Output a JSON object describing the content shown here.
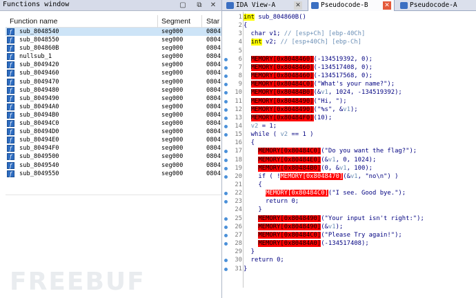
{
  "functions_window": {
    "title": "Functions window",
    "columns": [
      "Function name",
      "Segment",
      "Star"
    ],
    "rows": [
      {
        "name": "sub_8048540",
        "segment": "seg000",
        "start": "0804",
        "selected": true
      },
      {
        "name": "sub_8048550",
        "segment": "seg000",
        "start": "0804"
      },
      {
        "name": "sub_804860B",
        "segment": "seg000",
        "start": "0804"
      },
      {
        "name": "nullsub_1",
        "segment": "seg000",
        "start": "0804"
      },
      {
        "name": "sub_8049420",
        "segment": "seg000",
        "start": "0804"
      },
      {
        "name": "sub_8049460",
        "segment": "seg000",
        "start": "0804"
      },
      {
        "name": "sub_8049470",
        "segment": "seg000",
        "start": "0804"
      },
      {
        "name": "sub_8049480",
        "segment": "seg000",
        "start": "0804"
      },
      {
        "name": "sub_8049490",
        "segment": "seg000",
        "start": "0804"
      },
      {
        "name": "sub_80494A0",
        "segment": "seg000",
        "start": "0804"
      },
      {
        "name": "sub_80494B0",
        "segment": "seg000",
        "start": "0804"
      },
      {
        "name": "sub_80494C0",
        "segment": "seg000",
        "start": "0804"
      },
      {
        "name": "sub_80494D0",
        "segment": "seg000",
        "start": "0804"
      },
      {
        "name": "sub_80494E0",
        "segment": "seg000",
        "start": "0804"
      },
      {
        "name": "sub_80494F0",
        "segment": "seg000",
        "start": "0804"
      },
      {
        "name": "sub_8049500",
        "segment": "seg000",
        "start": "0804"
      },
      {
        "name": "sub_8049540",
        "segment": "seg000",
        "start": "0804"
      },
      {
        "name": "sub_8049550",
        "segment": "seg000",
        "start": "0804"
      }
    ]
  },
  "tabs": [
    {
      "label": "IDA View-A",
      "icon_color": "#3b6fc2",
      "active": false
    },
    {
      "label": "Pseudocode-B",
      "icon_color": "#3b6fc2",
      "active": true
    },
    {
      "label": "Pseudocode-A",
      "icon_color": "#3b6fc2",
      "active": false
    }
  ],
  "code_lines": [
    {
      "n": "1",
      "dot": false,
      "parts": [
        [
          "kw",
          "int"
        ],
        [
          "t",
          " sub_804860B()"
        ]
      ]
    },
    {
      "n": "2",
      "dot": false,
      "parts": [
        [
          "t",
          "{"
        ]
      ]
    },
    {
      "n": "3",
      "dot": false,
      "parts": [
        [
          "t",
          "  char v1; "
        ],
        [
          "v",
          "// [esp+Ch] [ebp-40Ch]"
        ]
      ]
    },
    {
      "n": "4",
      "dot": false,
      "parts": [
        [
          "t",
          "  "
        ],
        [
          "kw",
          "int"
        ],
        [
          "t",
          " v2; "
        ],
        [
          "v",
          "// [esp+40Ch] [ebp-Ch]"
        ]
      ]
    },
    {
      "n": "5",
      "dot": false,
      "parts": [
        [
          "t",
          ""
        ]
      ]
    },
    {
      "n": "6",
      "dot": true,
      "parts": [
        [
          "t",
          "  "
        ],
        [
          "m",
          "MEMORY[0x8048460]"
        ],
        [
          "t",
          "(-134519392, 0);"
        ]
      ]
    },
    {
      "n": "7",
      "dot": true,
      "parts": [
        [
          "t",
          "  "
        ],
        [
          "m",
          "MEMORY[0x8048460]"
        ],
        [
          "t",
          "(-134517408, 0);"
        ]
      ]
    },
    {
      "n": "8",
      "dot": true,
      "parts": [
        [
          "t",
          "  "
        ],
        [
          "m",
          "MEMORY[0x8048460]"
        ],
        [
          "t",
          "(-134517568, 0);"
        ]
      ]
    },
    {
      "n": "9",
      "dot": true,
      "parts": [
        [
          "t",
          "  "
        ],
        [
          "m",
          "MEMORY[0x80484C0]"
        ],
        [
          "t",
          "(\"What's your name?\");"
        ]
      ]
    },
    {
      "n": "10",
      "dot": true,
      "parts": [
        [
          "t",
          "  "
        ],
        [
          "m",
          "MEMORY[0x80484B0]"
        ],
        [
          "t",
          "(&"
        ],
        [
          "v",
          "v1"
        ],
        [
          "t",
          ", 1024, -134519392);"
        ]
      ]
    },
    {
      "n": "11",
      "dot": true,
      "parts": [
        [
          "t",
          "  "
        ],
        [
          "m",
          "MEMORY[0x8048490]"
        ],
        [
          "t",
          "(\"Hi, \");"
        ]
      ]
    },
    {
      "n": "12",
      "dot": true,
      "parts": [
        [
          "t",
          "  "
        ],
        [
          "m",
          "MEMORY[0x8048490]"
        ],
        [
          "t",
          "(\"%s\", &"
        ],
        [
          "v",
          "v1"
        ],
        [
          "t",
          ");"
        ]
      ]
    },
    {
      "n": "13",
      "dot": true,
      "parts": [
        [
          "t",
          "  "
        ],
        [
          "m",
          "MEMORY[0x80484F0]"
        ],
        [
          "t",
          "(10);"
        ]
      ]
    },
    {
      "n": "14",
      "dot": true,
      "parts": [
        [
          "t",
          "  "
        ],
        [
          "v",
          "v2"
        ],
        [
          "t",
          " = 1;"
        ]
      ]
    },
    {
      "n": "15",
      "dot": true,
      "parts": [
        [
          "t",
          "  while ( "
        ],
        [
          "v",
          "v2"
        ],
        [
          "t",
          " == 1 )"
        ]
      ]
    },
    {
      "n": "16",
      "dot": false,
      "parts": [
        [
          "t",
          "  {"
        ]
      ]
    },
    {
      "n": "17",
      "dot": true,
      "parts": [
        [
          "t",
          "    "
        ],
        [
          "m",
          "MEMORY[0x80484C0]"
        ],
        [
          "t",
          "(\"Do you want the flag?\");"
        ]
      ]
    },
    {
      "n": "18",
      "dot": true,
      "parts": [
        [
          "t",
          "    "
        ],
        [
          "m",
          "MEMORY[0x80484E0]"
        ],
        [
          "t",
          "(&"
        ],
        [
          "v",
          "v1"
        ],
        [
          "t",
          ", 0, 1024);"
        ]
      ]
    },
    {
      "n": "19",
      "dot": true,
      "parts": [
        [
          "t",
          "    "
        ],
        [
          "m",
          "MEMORY[0x80484B0]"
        ],
        [
          "t",
          "(0, &"
        ],
        [
          "v",
          "v1"
        ],
        [
          "t",
          ", 100);"
        ]
      ]
    },
    {
      "n": "20",
      "dot": true,
      "parts": [
        [
          "t",
          "    if ( !"
        ],
        [
          "ms",
          "MEMORY[0x8048470]"
        ],
        [
          "t",
          "(&"
        ],
        [
          "v",
          "v1"
        ],
        [
          "t",
          ", \"no\\n\") )"
        ]
      ]
    },
    {
      "n": "21",
      "dot": false,
      "parts": [
        [
          "t",
          "    {"
        ]
      ]
    },
    {
      "n": "22",
      "dot": true,
      "parts": [
        [
          "t",
          "      "
        ],
        [
          "ms",
          "MEMORY[0x80484C0]"
        ],
        [
          "t",
          "(\"I see. Good bye.\");"
        ]
      ]
    },
    {
      "n": "23",
      "dot": true,
      "parts": [
        [
          "t",
          "      return 0;"
        ]
      ]
    },
    {
      "n": "24",
      "dot": false,
      "parts": [
        [
          "t",
          "    }"
        ]
      ]
    },
    {
      "n": "25",
      "dot": true,
      "parts": [
        [
          "t",
          "    "
        ],
        [
          "m",
          "MEMORY[0x8048490]"
        ],
        [
          "t",
          "(\"Your input isn't right:\");"
        ]
      ]
    },
    {
      "n": "26",
      "dot": true,
      "parts": [
        [
          "t",
          "    "
        ],
        [
          "m",
          "MEMORY[0x8048490]"
        ],
        [
          "t",
          "(&"
        ],
        [
          "v",
          "v1"
        ],
        [
          "t",
          ");"
        ]
      ]
    },
    {
      "n": "27",
      "dot": true,
      "parts": [
        [
          "t",
          "    "
        ],
        [
          "m",
          "MEMORY[0x80484C0]"
        ],
        [
          "t",
          "(\"Please Try again!\");"
        ]
      ]
    },
    {
      "n": "28",
      "dot": true,
      "parts": [
        [
          "t",
          "    "
        ],
        [
          "m",
          "MEMORY[0x80484A0]"
        ],
        [
          "t",
          "(-134517408);"
        ]
      ]
    },
    {
      "n": "29",
      "dot": false,
      "parts": [
        [
          "t",
          "  }"
        ]
      ]
    },
    {
      "n": "30",
      "dot": true,
      "parts": [
        [
          "t",
          "  return 0;"
        ]
      ]
    },
    {
      "n": "31",
      "dot": true,
      "parts": [
        [
          "t",
          "}"
        ]
      ]
    }
  ],
  "watermark": "FREEBUF"
}
